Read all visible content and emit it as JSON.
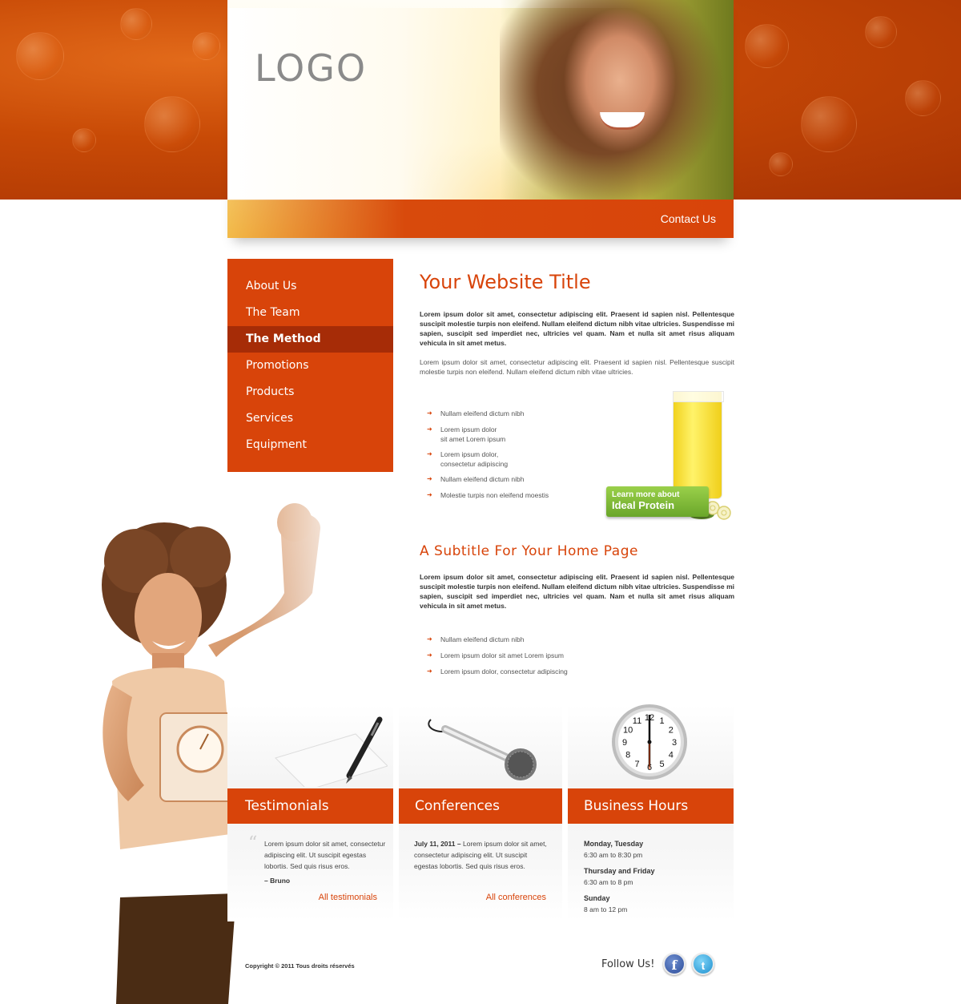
{
  "header": {
    "logo": "LOGO",
    "contact": "Contact Us"
  },
  "nav": {
    "items": [
      {
        "label": "About Us",
        "active": false
      },
      {
        "label": "The Team",
        "active": false
      },
      {
        "label": "The Method",
        "active": true
      },
      {
        "label": "Promotions",
        "active": false
      },
      {
        "label": "Products",
        "active": false
      },
      {
        "label": "Services",
        "active": false
      },
      {
        "label": "Equipment",
        "active": false
      }
    ]
  },
  "main": {
    "title": "Your Website Title",
    "lead": "Lorem ipsum dolor sit amet, consectetur adipiscing elit. Praesent id sapien nisl. Pellentesque suscipit molestie turpis non eleifend. Nullam eleifend dictum nibh vitae ultricies. Suspendisse mi sapien, suscipit sed imperdiet nec, ultricies vel quam. Nam et nulla sit amet risus aliquam vehicula in sit amet metus.",
    "body": "Lorem ipsum dolor sit amet, consectetur adipiscing elit. Praesent id sapien nisl. Pellentesque suscipit molestie turpis non eleifend. Nullam eleifend dictum nibh vitae ultricies.",
    "bullets": [
      {
        "line1": "Nullam eleifend dictum nibh",
        "line2": ""
      },
      {
        "line1": "Lorem ipsum dolor",
        "line2": "sit amet Lorem ipsum"
      },
      {
        "line1": "Lorem ipsum dolor,",
        "line2": "consectetur adipiscing"
      },
      {
        "line1": "Nullam eleifend dictum nibh",
        "line2": ""
      },
      {
        "line1": "Molestie turpis non eleifend moestis",
        "line2": ""
      }
    ],
    "promo": {
      "small": "Learn more about",
      "big": "Ideal Protein"
    },
    "subtitle": "A Subtitle For Your Home Page",
    "sub_lead": "Lorem ipsum dolor sit amet, consectetur adipiscing elit. Praesent id sapien nisl. Pellentesque suscipit molestie turpis non eleifend. Nullam eleifend dictum nibh vitae ultricies. Suspendisse mi sapien, suscipit sed imperdiet nec, ultricies vel quam. Nam et nulla sit amet risus aliquam vehicula in sit amet metus.",
    "bullets2": [
      "Nullam eleifend dictum nibh",
      "Lorem ipsum dolor sit amet Lorem ipsum",
      "Lorem ipsum dolor, consectetur adipiscing"
    ]
  },
  "features": {
    "testimonials": {
      "title": "Testimonials",
      "quote": "Lorem ipsum dolor sit amet, consectetur adipiscing elit. Ut suscipit egestas lobortis. Sed quis risus eros.",
      "author": "– Bruno",
      "link": "All testimonials"
    },
    "conferences": {
      "title": "Conferences",
      "date": "July 11, 2011",
      "dash": "–",
      "text": "Lorem ipsum dolor sit amet, consectetur adipiscing elit. Ut suscipit egestas lobortis. Sed quis risus eros.",
      "link": "All conferences"
    },
    "hours": {
      "title": "Business Hours",
      "rows": [
        {
          "days": "Monday, Tuesday",
          "time": "6:30 am to 8:30 pm"
        },
        {
          "days": "Thursday and Friday",
          "time": "6:30 am to 8 pm"
        },
        {
          "days": "Sunday",
          "time": "8 am to 12 pm"
        }
      ]
    }
  },
  "footer": {
    "copyright": "Copyright © 2011 Tous droits réservés",
    "follow": "Follow Us!",
    "facebook_glyph": "f",
    "twitter_glyph": "t"
  },
  "clock": {
    "numbers": [
      "12",
      "1",
      "2",
      "3",
      "4",
      "5",
      "6",
      "7",
      "8",
      "9",
      "10",
      "11"
    ]
  },
  "colors": {
    "accent": "#d8440a",
    "accent_dark": "#a62c07",
    "promo_green": "#7ab83a"
  }
}
